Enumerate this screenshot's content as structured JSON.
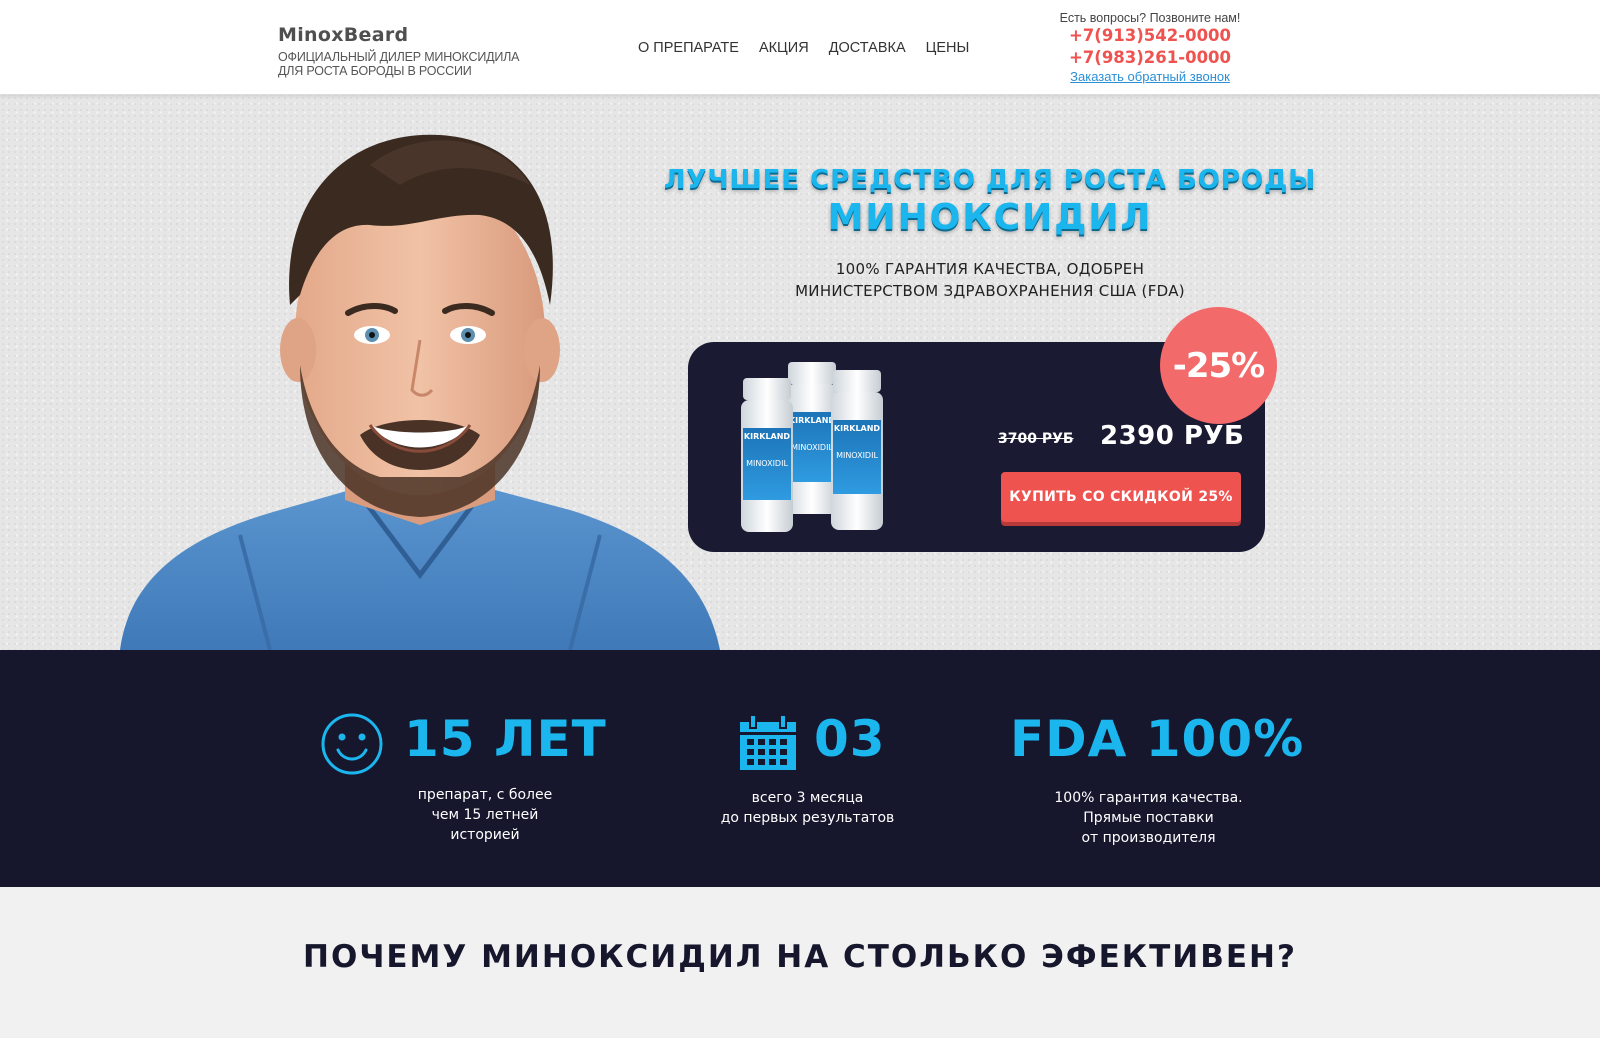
{
  "header": {
    "logo_name": "MinoxBeard",
    "logo_tagline_1": "ОФИЦИАЛЬНЫЙ ДИЛЕР МИНОКСИДИЛА",
    "logo_tagline_2": "ДЛЯ РОСТА БОРОДЫ В РОССИИ",
    "nav": [
      "О ПРЕПАРАТЕ",
      "АКЦИЯ",
      "ДОСТАВКА",
      "ЦЕНЫ"
    ],
    "contact_question": "Есть вопросы? Позвоните нам!",
    "phone_1": "+7(913)542-0000",
    "phone_2": "+7(983)261-0000",
    "callback_link": "Заказать обратный звонок"
  },
  "hero": {
    "title_line1": "ЛУЧШЕЕ СРЕДСТВО ДЛЯ РОСТА БОРОДЫ",
    "title_line2": "МИНОКСИДИЛ",
    "guarantee_line1": "100% ГАРАНТИЯ КАЧЕСТВА, ОДОБРЕН",
    "guarantee_line2": "МИНИСТЕРСТВОМ ЗДРАВОХРАНЕНИЯ США (FDA)",
    "discount": "-25%",
    "old_price": "3700 РУБ",
    "new_price": "2390 РУБ",
    "buy_button": "КУПИТЬ СО СКИДКОЙ 25%",
    "bottle_brand": "KIRKLAND",
    "bottle_label": "MINOXIDIL"
  },
  "stats": [
    {
      "icon": "smiley-icon",
      "value": "15 ЛЕТ",
      "desc": [
        "препарат, с более",
        "чем 15 летней",
        "историей"
      ]
    },
    {
      "icon": "calendar-icon",
      "value": "03",
      "desc": [
        "всего 3 месяца",
        "до первых результатов"
      ]
    },
    {
      "icon": "",
      "value": "FDA 100%",
      "desc": [
        "100% гарантия качества.",
        "Прямые поставки",
        "от производителя"
      ]
    }
  ],
  "why": {
    "title": "ПОЧЕМУ МИНОКСИДИЛ НА СТОЛЬКО ЭФЕКТИВЕН?"
  },
  "colors": {
    "accent_blue": "#1cb6ee",
    "accent_red": "#ef5350",
    "dark_navy": "#16162d"
  }
}
